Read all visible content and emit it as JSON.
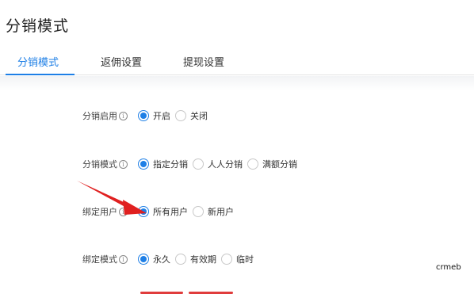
{
  "page": {
    "title": "分销模式"
  },
  "tabs": [
    {
      "label": "分销模式",
      "active": true
    },
    {
      "label": "返佣设置",
      "active": false
    },
    {
      "label": "提现设置",
      "active": false
    }
  ],
  "form": {
    "rows": [
      {
        "label": "分销启用",
        "options": [
          {
            "label": "开启",
            "checked": true
          },
          {
            "label": "关闭",
            "checked": false
          }
        ]
      },
      {
        "label": "分销模式",
        "options": [
          {
            "label": "指定分销",
            "checked": true
          },
          {
            "label": "人人分销",
            "checked": false
          },
          {
            "label": "满额分销",
            "checked": false
          }
        ]
      },
      {
        "label": "绑定用户",
        "options": [
          {
            "label": "所有用户",
            "checked": true
          },
          {
            "label": "新用户",
            "checked": false
          }
        ]
      },
      {
        "label": "绑定模式",
        "options": [
          {
            "label": "永久",
            "checked": true
          },
          {
            "label": "有效期",
            "checked": false
          },
          {
            "label": "临时",
            "checked": false
          }
        ]
      }
    ]
  },
  "info_icon_glyph": "i",
  "watermark": "crmeb",
  "colors": {
    "accent": "#1e7fe6",
    "arrow": "#e02020",
    "button": "#e03c3c"
  }
}
